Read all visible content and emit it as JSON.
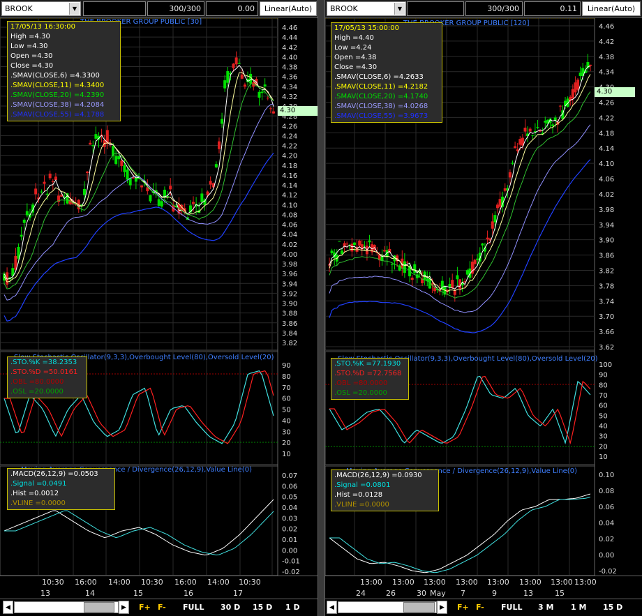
{
  "panels": [
    {
      "id": "L",
      "topbar": {
        "symbol": "BROOK",
        "count": "300/300",
        "value": "0.00",
        "scale": "Linear(Auto)"
      },
      "chart_title": "THE BROOKER GROUP PUBLIC [30]",
      "legend": {
        "datetime": "17/05/13 16:30:00",
        "high": "High =4.30",
        "low": "Low =4.30",
        "open": "Open =4.30",
        "close": "Close =4.30",
        "sma6": ".SMAV(CLOSE,6) =4.3300",
        "sma11": ".SMAV(CLOSE,11) =4.3400",
        "sma20": ".SMAV(CLOSE,20) =4.2390",
        "sma38": ".SMAV(CLOSE,38) =4.2084",
        "sma55": ".SMAV(CLOSE,55) =4.1788"
      },
      "last_price": "4.30",
      "price_ticks": [
        "4.46",
        "4.44",
        "4.42",
        "4.40",
        "4.38",
        "4.36",
        "4.34",
        "4.32",
        "4.30",
        "4.28",
        "4.26",
        "4.24",
        "4.22",
        "4.20",
        "4.18",
        "4.16",
        "4.14",
        "4.12",
        "4.10",
        "4.08",
        "4.06",
        "4.04",
        "4.02",
        "4.00",
        "3.98",
        "3.96",
        "3.94",
        "3.92",
        "3.90",
        "3.88",
        "3.86",
        "3.84",
        "3.82"
      ],
      "sto_title": "Slow Stochastic Oscillator(9,3,3),Overbought Level(80),Oversold Level(20)",
      "sto_legend": {
        "k": ".STO.%K =38.2353",
        "d": ".STO.%D =50.0161",
        "obl": ".OBL =80.0000",
        "osl": ".OSL =20.0000"
      },
      "sto_ticks": [
        "90",
        "80",
        "70",
        "60",
        "50",
        "40",
        "30",
        "20",
        "10"
      ],
      "macd_title": "Moving Average Convergence / Divergence(26,12,9),Value Line(0)",
      "macd_legend": {
        "macd": ".MACD(26,12,9) =0.0503",
        "signal": ".Signal =0.0491",
        "hist": ".Hist =0.0012",
        "vline": ".VLINE =0.0000"
      },
      "macd_ticks": [
        "0.07",
        "0.06",
        "0.05",
        "0.04",
        "0.03",
        "0.02",
        "0.01",
        "0.00",
        "-0.01",
        "-0.02"
      ],
      "time_labels": [
        "10:30",
        "16:00",
        "14:00",
        "10:30",
        "16:00",
        "14:00",
        "10:30"
      ],
      "date_labels": [
        "13",
        "14",
        "15",
        "16",
        "17"
      ],
      "bottom": {
        "f_plus": "F+",
        "f_minus": "F-",
        "b1": "FULL",
        "b2": "30 D",
        "b3": "15 D",
        "b4": "1 D"
      }
    },
    {
      "id": "R",
      "topbar": {
        "symbol": "BROOK",
        "count": "300/300",
        "value": "0.11",
        "scale": "Linear(Auto)"
      },
      "chart_title": "THE BROOKER GROUP PUBLIC [120]",
      "legend": {
        "datetime": "17/05/13 15:00:00",
        "high": "High =4.40",
        "low": "Low =4.24",
        "open": "Open =4.38",
        "close": "Close =4.30",
        "sma6": ".SMAV(CLOSE,6) =4.2633",
        "sma11": ".SMAV(CLOSE,11) =4.2182",
        "sma20": ".SMAV(CLOSE,20) =4.1740",
        "sma38": ".SMAV(CLOSE,38) =4.0268",
        "sma55": ".SMAV(CLOSE,55) =3.9673"
      },
      "last_price": "4.30",
      "price_ticks": [
        "4.46",
        "4.42",
        "4.38",
        "4.34",
        "4.30",
        "4.26",
        "4.22",
        "4.18",
        "4.14",
        "4.10",
        "4.06",
        "4.02",
        "3.98",
        "3.94",
        "3.90",
        "3.86",
        "3.82",
        "3.78",
        "3.74",
        "3.70",
        "3.66",
        "3.62"
      ],
      "sto_title": "Slow Stochastic Oscillator(9,3,3),Overbought Level(80),Oversold Level(20)",
      "sto_legend": {
        "k": ".STO.%K =77.1930",
        "d": ".STO.%D =72.7568",
        "obl": ".OBL =80.0000",
        "osl": ".OSL =20.0000"
      },
      "sto_ticks": [
        "100",
        "90",
        "80",
        "70",
        "60",
        "50",
        "40",
        "30",
        "20",
        "10"
      ],
      "macd_title": "Moving Average Convergence / Divergence(26,12,9),Value Line(0)",
      "macd_legend": {
        "macd": ".MACD(26,12,9) =0.0930",
        "signal": ".Signal =0.0801",
        "hist": ".Hist =0.0128",
        "vline": ".VLINE =0.0000"
      },
      "macd_ticks": [
        "0.10",
        "0.08",
        "0.06",
        "0.04",
        "0.02",
        "0.00",
        "-0.02"
      ],
      "time_labels": [
        "13:00",
        "13:00",
        "13:00",
        "13:00",
        "13:00",
        "13:00",
        "13:00",
        "13:00"
      ],
      "date_labels": [
        "24",
        "26",
        "30",
        "May",
        "7",
        "9",
        "13",
        "15"
      ],
      "bottom": {
        "f_plus": "F+",
        "f_minus": "F-",
        "b1": "FULL",
        "b2": "3 M",
        "b3": "1 M",
        "b4": "15 D"
      }
    }
  ],
  "colors": {
    "up_candle": "#00e000",
    "down_candle": "#e02020",
    "sma6": "#ffffff",
    "sma11": "#ffffa0",
    "sma20": "#30c030",
    "sma38": "#9090ff",
    "sma55": "#2040ff",
    "sto_k": "#40e0e0",
    "sto_d": "#ff2020",
    "grid": "#2a2a2a",
    "legend_border": "#c8c000"
  }
}
